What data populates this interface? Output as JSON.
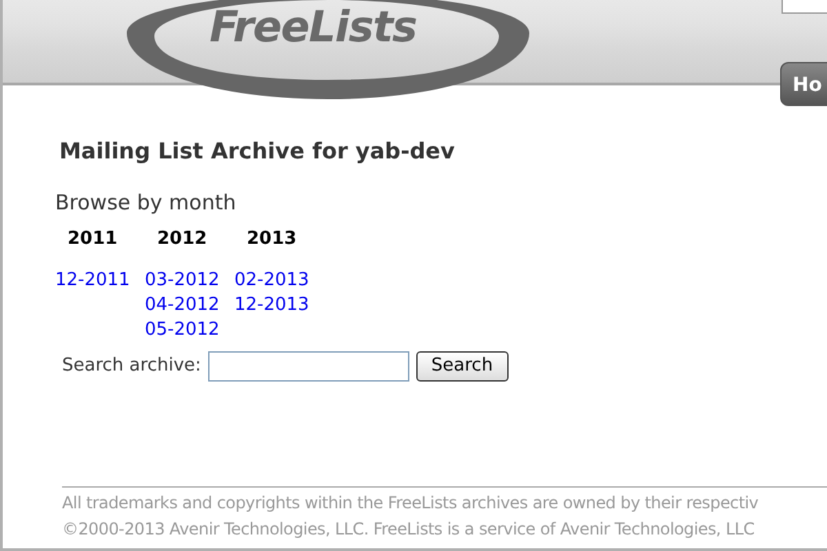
{
  "header": {
    "logo": "FreeLists",
    "nav_tab": "Ho"
  },
  "title": "Mailing List Archive for yab-dev",
  "browse_heading": "Browse by month",
  "years": [
    {
      "year": "2011",
      "months": [
        "12-2011"
      ]
    },
    {
      "year": "2012",
      "months": [
        "03-2012",
        "04-2012",
        "05-2012"
      ]
    },
    {
      "year": "2013",
      "months": [
        "02-2013",
        "12-2013"
      ]
    }
  ],
  "search": {
    "label": "Search archive:",
    "button": "Search"
  },
  "footer": [
    "All trademarks and copyrights within the FreeLists archives are owned by their respectiv",
    "©2000-2013 Avenir Technologies, LLC. FreeLists is a service of Avenir Technologies, LLC"
  ]
}
